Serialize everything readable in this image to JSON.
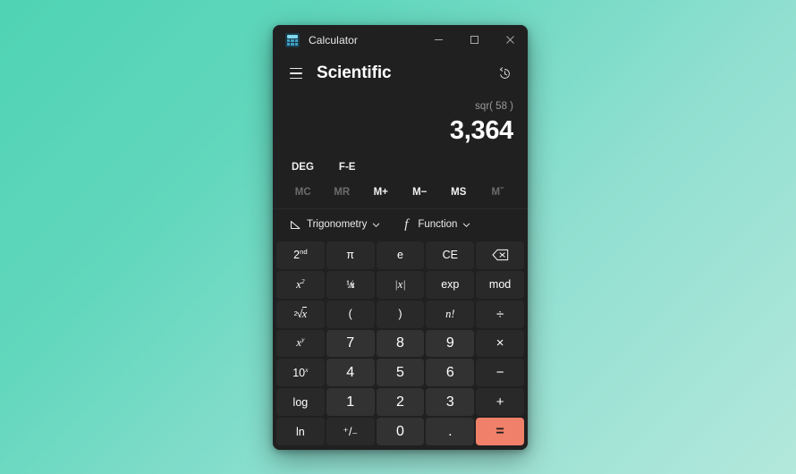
{
  "window": {
    "app_icon": "calculator-icon",
    "title": "Calculator",
    "controls": {
      "minimize": "minimize-icon",
      "maximize": "maximize-icon",
      "close": "close-icon"
    }
  },
  "header": {
    "menu_icon": "hamburger-menu-icon",
    "mode_title": "Scientific",
    "history_icon": "history-clock-icon"
  },
  "display": {
    "expression": "sqr( 58 )",
    "result": "3,364"
  },
  "toggles": [
    {
      "label": "DEG",
      "name": "angle-unit-toggle"
    },
    {
      "label": "F-E",
      "name": "fixed-exponent-toggle"
    }
  ],
  "memory": [
    {
      "label": "MC",
      "name": "memory-clear-button",
      "enabled": false
    },
    {
      "label": "MR",
      "name": "memory-recall-button",
      "enabled": false
    },
    {
      "label": "M+",
      "name": "memory-add-button",
      "enabled": true
    },
    {
      "label": "M−",
      "name": "memory-subtract-button",
      "enabled": true
    },
    {
      "label": "MS",
      "name": "memory-store-button",
      "enabled": true
    },
    {
      "label": "Mˇ",
      "name": "memory-list-button",
      "enabled": false
    }
  ],
  "dropdowns": [
    {
      "label": "Trigonometry",
      "icon": "angle-triangle-icon",
      "chevron": "chevron-down-icon"
    },
    {
      "label": "Function",
      "icon": "function-f-icon",
      "chevron": "chevron-down-icon"
    }
  ],
  "keypad": {
    "rows": [
      [
        {
          "label": "2nd",
          "name": "second-function-button",
          "kind": "fn",
          "sup": "nd",
          "base": "2"
        },
        {
          "label": "π",
          "name": "pi-button",
          "kind": "fn"
        },
        {
          "label": "e",
          "name": "euler-button",
          "kind": "fn"
        },
        {
          "label": "CE",
          "name": "clear-entry-button",
          "kind": "fn"
        },
        {
          "label": "⌫",
          "name": "backspace-button",
          "kind": "icon-backspace"
        }
      ],
      [
        {
          "label": "x²",
          "name": "square-button",
          "kind": "fn",
          "base": "x",
          "sup": "2",
          "italic": true
        },
        {
          "label": "1/x",
          "name": "reciprocal-button",
          "kind": "fn"
        },
        {
          "label": "|x|",
          "name": "absolute-value-button",
          "kind": "fn"
        },
        {
          "label": "exp",
          "name": "exponent-button",
          "kind": "fn"
        },
        {
          "label": "mod",
          "name": "modulo-button",
          "kind": "fn"
        }
      ],
      [
        {
          "label": "²√x",
          "name": "square-root-button",
          "kind": "fn"
        },
        {
          "label": "(",
          "name": "open-paren-button",
          "kind": "fn"
        },
        {
          "label": ")",
          "name": "close-paren-button",
          "kind": "fn"
        },
        {
          "label": "n!",
          "name": "factorial-button",
          "kind": "fn",
          "italic": true
        },
        {
          "label": "÷",
          "name": "divide-button",
          "kind": "op"
        }
      ],
      [
        {
          "label": "xʸ",
          "name": "power-button",
          "kind": "fn",
          "base": "x",
          "sup": "y",
          "italic": true
        },
        {
          "label": "7",
          "name": "digit-7-button",
          "kind": "num"
        },
        {
          "label": "8",
          "name": "digit-8-button",
          "kind": "num"
        },
        {
          "label": "9",
          "name": "digit-9-button",
          "kind": "num"
        },
        {
          "label": "×",
          "name": "multiply-button",
          "kind": "op"
        }
      ],
      [
        {
          "label": "10ˣ",
          "name": "ten-power-button",
          "kind": "fn",
          "base": "10",
          "sup": "x",
          "italic": true
        },
        {
          "label": "4",
          "name": "digit-4-button",
          "kind": "num"
        },
        {
          "label": "5",
          "name": "digit-5-button",
          "kind": "num"
        },
        {
          "label": "6",
          "name": "digit-6-button",
          "kind": "num"
        },
        {
          "label": "−",
          "name": "subtract-button",
          "kind": "op"
        }
      ],
      [
        {
          "label": "log",
          "name": "log-button",
          "kind": "fn"
        },
        {
          "label": "1",
          "name": "digit-1-button",
          "kind": "num"
        },
        {
          "label": "2",
          "name": "digit-2-button",
          "kind": "num"
        },
        {
          "label": "3",
          "name": "digit-3-button",
          "kind": "num"
        },
        {
          "label": "+",
          "name": "add-button",
          "kind": "op"
        }
      ],
      [
        {
          "label": "ln",
          "name": "natural-log-button",
          "kind": "fn"
        },
        {
          "label": "⁺/₋",
          "name": "sign-toggle-button",
          "kind": "fn"
        },
        {
          "label": "0",
          "name": "digit-0-button",
          "kind": "num"
        },
        {
          "label": ".",
          "name": "decimal-point-button",
          "kind": "num"
        },
        {
          "label": "=",
          "name": "equals-button",
          "kind": "equals"
        }
      ]
    ]
  },
  "colors": {
    "accent_equals": "#f08069",
    "window_bg": "#202020",
    "key_bg": "#2b2b2b",
    "desktop_gradient_start": "#4fd3b4",
    "desktop_gradient_end": "#b3e8dc"
  }
}
